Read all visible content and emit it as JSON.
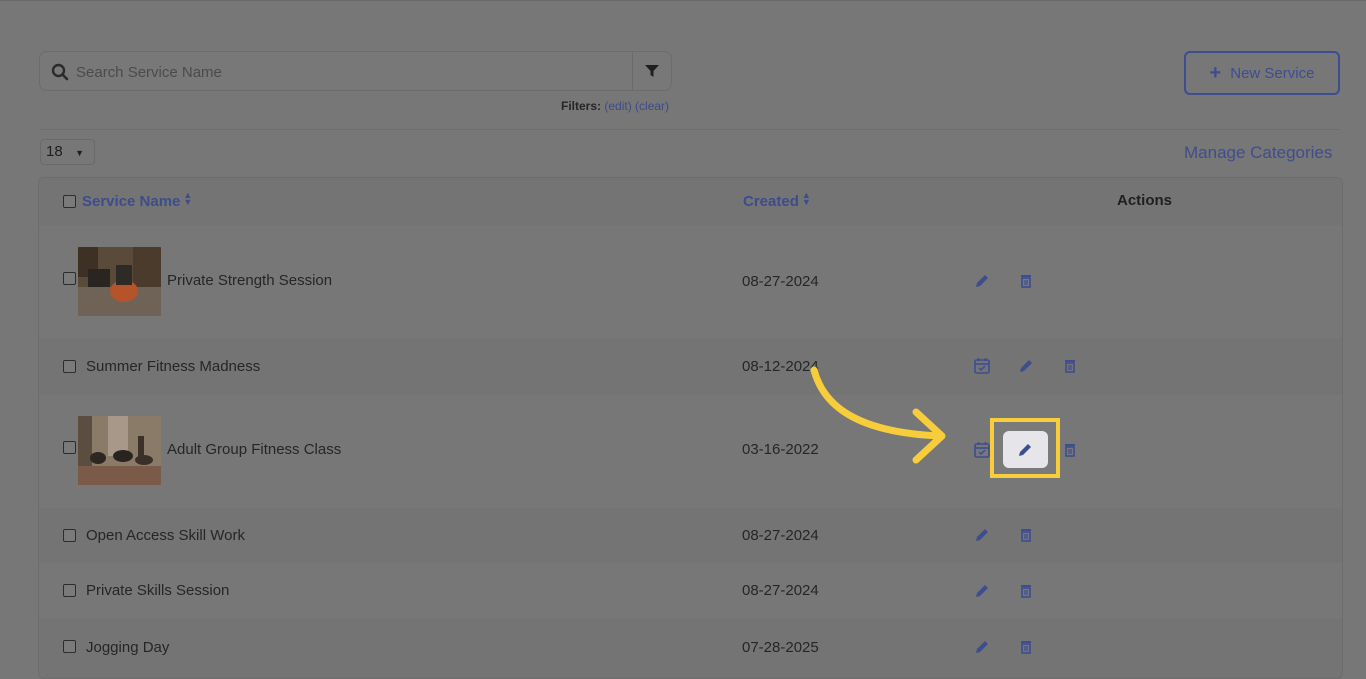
{
  "search": {
    "placeholder": "Search Service Name"
  },
  "filters": {
    "label": "Filters:",
    "edit": "(edit)",
    "clear": "(clear)"
  },
  "new_service_label": "New Service",
  "page_size": "18",
  "manage_categories": "Manage Categories",
  "table": {
    "columns": {
      "name": "Service Name",
      "created": "Created",
      "actions": "Actions"
    },
    "rows": [
      {
        "name": "Private Strength Session",
        "created": "08-27-2024"
      },
      {
        "name": "Summer Fitness Madness",
        "created": "08-12-2024"
      },
      {
        "name": "Adult Group Fitness Class",
        "created": "03-16-2022"
      },
      {
        "name": "Open Access Skill Work",
        "created": "08-27-2024"
      },
      {
        "name": "Private Skills Session",
        "created": "08-27-2024"
      },
      {
        "name": "Jogging Day",
        "created": "07-28-2025"
      }
    ]
  },
  "colors": {
    "accent": "#3d4d8f",
    "highlight": "#f7cd3c",
    "overlay": "#777777"
  }
}
